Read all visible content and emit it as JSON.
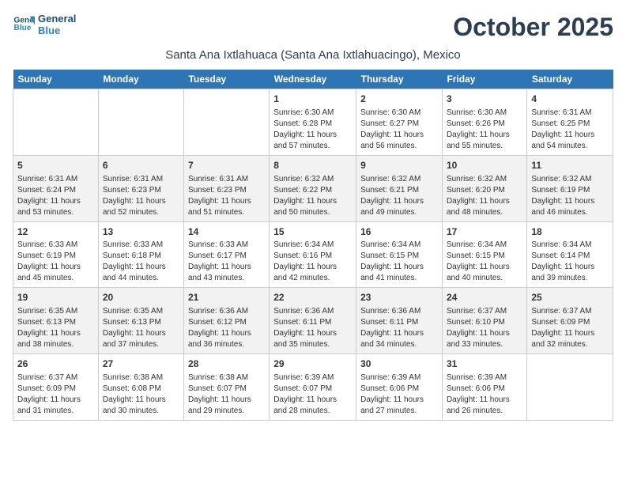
{
  "header": {
    "logo_line1": "General",
    "logo_line2": "Blue",
    "month_title": "October 2025",
    "location": "Santa Ana Ixtlahuaca (Santa Ana Ixtlahuacingo), Mexico"
  },
  "weekdays": [
    "Sunday",
    "Monday",
    "Tuesday",
    "Wednesday",
    "Thursday",
    "Friday",
    "Saturday"
  ],
  "weeks": [
    [
      {
        "day": "",
        "content": ""
      },
      {
        "day": "",
        "content": ""
      },
      {
        "day": "",
        "content": ""
      },
      {
        "day": "1",
        "content": "Sunrise: 6:30 AM\nSunset: 6:28 PM\nDaylight: 11 hours and 57 minutes."
      },
      {
        "day": "2",
        "content": "Sunrise: 6:30 AM\nSunset: 6:27 PM\nDaylight: 11 hours and 56 minutes."
      },
      {
        "day": "3",
        "content": "Sunrise: 6:30 AM\nSunset: 6:26 PM\nDaylight: 11 hours and 55 minutes."
      },
      {
        "day": "4",
        "content": "Sunrise: 6:31 AM\nSunset: 6:25 PM\nDaylight: 11 hours and 54 minutes."
      }
    ],
    [
      {
        "day": "5",
        "content": "Sunrise: 6:31 AM\nSunset: 6:24 PM\nDaylight: 11 hours and 53 minutes."
      },
      {
        "day": "6",
        "content": "Sunrise: 6:31 AM\nSunset: 6:23 PM\nDaylight: 11 hours and 52 minutes."
      },
      {
        "day": "7",
        "content": "Sunrise: 6:31 AM\nSunset: 6:23 PM\nDaylight: 11 hours and 51 minutes."
      },
      {
        "day": "8",
        "content": "Sunrise: 6:32 AM\nSunset: 6:22 PM\nDaylight: 11 hours and 50 minutes."
      },
      {
        "day": "9",
        "content": "Sunrise: 6:32 AM\nSunset: 6:21 PM\nDaylight: 11 hours and 49 minutes."
      },
      {
        "day": "10",
        "content": "Sunrise: 6:32 AM\nSunset: 6:20 PM\nDaylight: 11 hours and 48 minutes."
      },
      {
        "day": "11",
        "content": "Sunrise: 6:32 AM\nSunset: 6:19 PM\nDaylight: 11 hours and 46 minutes."
      }
    ],
    [
      {
        "day": "12",
        "content": "Sunrise: 6:33 AM\nSunset: 6:19 PM\nDaylight: 11 hours and 45 minutes."
      },
      {
        "day": "13",
        "content": "Sunrise: 6:33 AM\nSunset: 6:18 PM\nDaylight: 11 hours and 44 minutes."
      },
      {
        "day": "14",
        "content": "Sunrise: 6:33 AM\nSunset: 6:17 PM\nDaylight: 11 hours and 43 minutes."
      },
      {
        "day": "15",
        "content": "Sunrise: 6:34 AM\nSunset: 6:16 PM\nDaylight: 11 hours and 42 minutes."
      },
      {
        "day": "16",
        "content": "Sunrise: 6:34 AM\nSunset: 6:15 PM\nDaylight: 11 hours and 41 minutes."
      },
      {
        "day": "17",
        "content": "Sunrise: 6:34 AM\nSunset: 6:15 PM\nDaylight: 11 hours and 40 minutes."
      },
      {
        "day": "18",
        "content": "Sunrise: 6:34 AM\nSunset: 6:14 PM\nDaylight: 11 hours and 39 minutes."
      }
    ],
    [
      {
        "day": "19",
        "content": "Sunrise: 6:35 AM\nSunset: 6:13 PM\nDaylight: 11 hours and 38 minutes."
      },
      {
        "day": "20",
        "content": "Sunrise: 6:35 AM\nSunset: 6:13 PM\nDaylight: 11 hours and 37 minutes."
      },
      {
        "day": "21",
        "content": "Sunrise: 6:36 AM\nSunset: 6:12 PM\nDaylight: 11 hours and 36 minutes."
      },
      {
        "day": "22",
        "content": "Sunrise: 6:36 AM\nSunset: 6:11 PM\nDaylight: 11 hours and 35 minutes."
      },
      {
        "day": "23",
        "content": "Sunrise: 6:36 AM\nSunset: 6:11 PM\nDaylight: 11 hours and 34 minutes."
      },
      {
        "day": "24",
        "content": "Sunrise: 6:37 AM\nSunset: 6:10 PM\nDaylight: 11 hours and 33 minutes."
      },
      {
        "day": "25",
        "content": "Sunrise: 6:37 AM\nSunset: 6:09 PM\nDaylight: 11 hours and 32 minutes."
      }
    ],
    [
      {
        "day": "26",
        "content": "Sunrise: 6:37 AM\nSunset: 6:09 PM\nDaylight: 11 hours and 31 minutes."
      },
      {
        "day": "27",
        "content": "Sunrise: 6:38 AM\nSunset: 6:08 PM\nDaylight: 11 hours and 30 minutes."
      },
      {
        "day": "28",
        "content": "Sunrise: 6:38 AM\nSunset: 6:07 PM\nDaylight: 11 hours and 29 minutes."
      },
      {
        "day": "29",
        "content": "Sunrise: 6:39 AM\nSunset: 6:07 PM\nDaylight: 11 hours and 28 minutes."
      },
      {
        "day": "30",
        "content": "Sunrise: 6:39 AM\nSunset: 6:06 PM\nDaylight: 11 hours and 27 minutes."
      },
      {
        "day": "31",
        "content": "Sunrise: 6:39 AM\nSunset: 6:06 PM\nDaylight: 11 hours and 26 minutes."
      },
      {
        "day": "",
        "content": ""
      }
    ]
  ]
}
